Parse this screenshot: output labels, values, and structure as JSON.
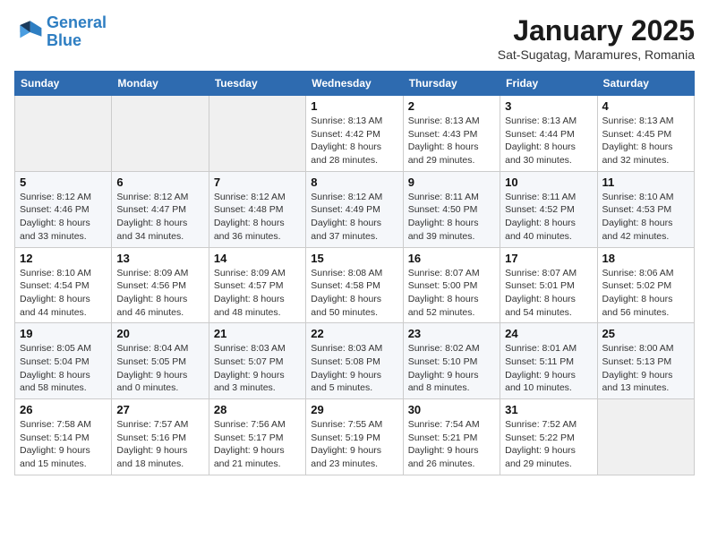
{
  "header": {
    "logo_line1": "General",
    "logo_line2": "Blue",
    "month_title": "January 2025",
    "location": "Sat-Sugatag, Maramures, Romania"
  },
  "weekdays": [
    "Sunday",
    "Monday",
    "Tuesday",
    "Wednesday",
    "Thursday",
    "Friday",
    "Saturday"
  ],
  "weeks": [
    [
      {
        "day": "",
        "info": ""
      },
      {
        "day": "",
        "info": ""
      },
      {
        "day": "",
        "info": ""
      },
      {
        "day": "1",
        "info": "Sunrise: 8:13 AM\nSunset: 4:42 PM\nDaylight: 8 hours and 28 minutes."
      },
      {
        "day": "2",
        "info": "Sunrise: 8:13 AM\nSunset: 4:43 PM\nDaylight: 8 hours and 29 minutes."
      },
      {
        "day": "3",
        "info": "Sunrise: 8:13 AM\nSunset: 4:44 PM\nDaylight: 8 hours and 30 minutes."
      },
      {
        "day": "4",
        "info": "Sunrise: 8:13 AM\nSunset: 4:45 PM\nDaylight: 8 hours and 32 minutes."
      }
    ],
    [
      {
        "day": "5",
        "info": "Sunrise: 8:12 AM\nSunset: 4:46 PM\nDaylight: 8 hours and 33 minutes."
      },
      {
        "day": "6",
        "info": "Sunrise: 8:12 AM\nSunset: 4:47 PM\nDaylight: 8 hours and 34 minutes."
      },
      {
        "day": "7",
        "info": "Sunrise: 8:12 AM\nSunset: 4:48 PM\nDaylight: 8 hours and 36 minutes."
      },
      {
        "day": "8",
        "info": "Sunrise: 8:12 AM\nSunset: 4:49 PM\nDaylight: 8 hours and 37 minutes."
      },
      {
        "day": "9",
        "info": "Sunrise: 8:11 AM\nSunset: 4:50 PM\nDaylight: 8 hours and 39 minutes."
      },
      {
        "day": "10",
        "info": "Sunrise: 8:11 AM\nSunset: 4:52 PM\nDaylight: 8 hours and 40 minutes."
      },
      {
        "day": "11",
        "info": "Sunrise: 8:10 AM\nSunset: 4:53 PM\nDaylight: 8 hours and 42 minutes."
      }
    ],
    [
      {
        "day": "12",
        "info": "Sunrise: 8:10 AM\nSunset: 4:54 PM\nDaylight: 8 hours and 44 minutes."
      },
      {
        "day": "13",
        "info": "Sunrise: 8:09 AM\nSunset: 4:56 PM\nDaylight: 8 hours and 46 minutes."
      },
      {
        "day": "14",
        "info": "Sunrise: 8:09 AM\nSunset: 4:57 PM\nDaylight: 8 hours and 48 minutes."
      },
      {
        "day": "15",
        "info": "Sunrise: 8:08 AM\nSunset: 4:58 PM\nDaylight: 8 hours and 50 minutes."
      },
      {
        "day": "16",
        "info": "Sunrise: 8:07 AM\nSunset: 5:00 PM\nDaylight: 8 hours and 52 minutes."
      },
      {
        "day": "17",
        "info": "Sunrise: 8:07 AM\nSunset: 5:01 PM\nDaylight: 8 hours and 54 minutes."
      },
      {
        "day": "18",
        "info": "Sunrise: 8:06 AM\nSunset: 5:02 PM\nDaylight: 8 hours and 56 minutes."
      }
    ],
    [
      {
        "day": "19",
        "info": "Sunrise: 8:05 AM\nSunset: 5:04 PM\nDaylight: 8 hours and 58 minutes."
      },
      {
        "day": "20",
        "info": "Sunrise: 8:04 AM\nSunset: 5:05 PM\nDaylight: 9 hours and 0 minutes."
      },
      {
        "day": "21",
        "info": "Sunrise: 8:03 AM\nSunset: 5:07 PM\nDaylight: 9 hours and 3 minutes."
      },
      {
        "day": "22",
        "info": "Sunrise: 8:03 AM\nSunset: 5:08 PM\nDaylight: 9 hours and 5 minutes."
      },
      {
        "day": "23",
        "info": "Sunrise: 8:02 AM\nSunset: 5:10 PM\nDaylight: 9 hours and 8 minutes."
      },
      {
        "day": "24",
        "info": "Sunrise: 8:01 AM\nSunset: 5:11 PM\nDaylight: 9 hours and 10 minutes."
      },
      {
        "day": "25",
        "info": "Sunrise: 8:00 AM\nSunset: 5:13 PM\nDaylight: 9 hours and 13 minutes."
      }
    ],
    [
      {
        "day": "26",
        "info": "Sunrise: 7:58 AM\nSunset: 5:14 PM\nDaylight: 9 hours and 15 minutes."
      },
      {
        "day": "27",
        "info": "Sunrise: 7:57 AM\nSunset: 5:16 PM\nDaylight: 9 hours and 18 minutes."
      },
      {
        "day": "28",
        "info": "Sunrise: 7:56 AM\nSunset: 5:17 PM\nDaylight: 9 hours and 21 minutes."
      },
      {
        "day": "29",
        "info": "Sunrise: 7:55 AM\nSunset: 5:19 PM\nDaylight: 9 hours and 23 minutes."
      },
      {
        "day": "30",
        "info": "Sunrise: 7:54 AM\nSunset: 5:21 PM\nDaylight: 9 hours and 26 minutes."
      },
      {
        "day": "31",
        "info": "Sunrise: 7:52 AM\nSunset: 5:22 PM\nDaylight: 9 hours and 29 minutes."
      },
      {
        "day": "",
        "info": ""
      }
    ]
  ]
}
